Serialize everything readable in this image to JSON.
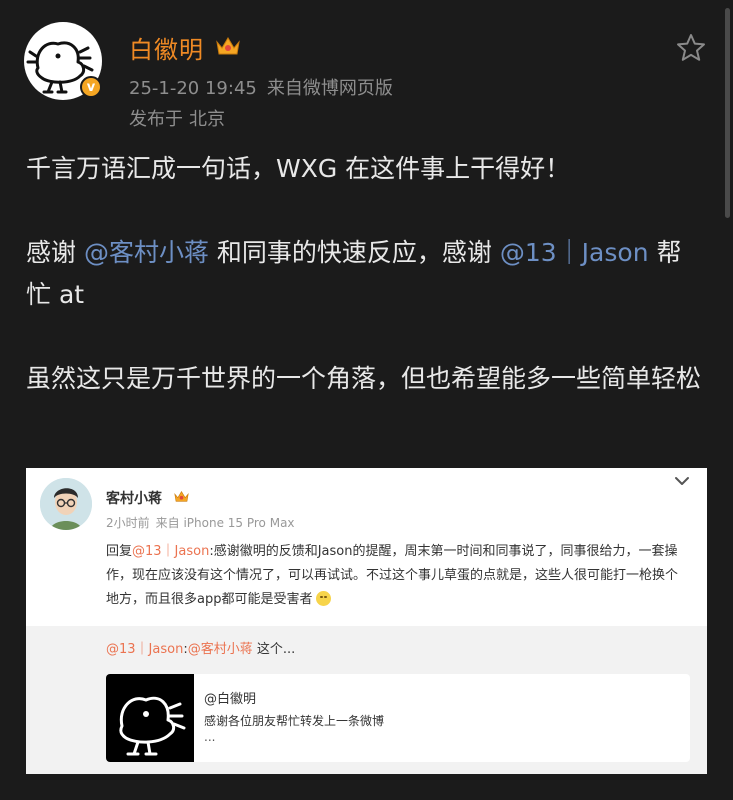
{
  "post": {
    "author": "白徽明",
    "timestamp": "25-1-20 19:45",
    "source": "来自微博网页版",
    "location_label": "发布于",
    "location": "北京",
    "colors": {
      "author": "#f08a24",
      "mention": "#6d8fc4",
      "verified": "#f5a623"
    },
    "line1": "千言万语汇成一句话，WXG 在这件事上干得好！",
    "p2_a": "感谢 ",
    "p2_mention1": "@客村小蒋",
    "p2_b": " 和同事的快速反应，感谢 ",
    "p2_mention2": "@13｜Jason",
    "p2_c": " 帮忙 at",
    "p3": "虽然这只是万千世界的一个角落，但也希望能多一些简单轻松"
  },
  "embed": {
    "name": "客村小蒋",
    "time": "2小时前",
    "source": "来自 iPhone 15 Pro Max",
    "reply_prefix": "回复",
    "reply_mention": "@13｜Jason",
    "reply_text": ":感谢徽明的反馈和Jason的提醒，周末第一时间和同事说了，同事很给力，一套操作，现在应该没有这个情况了，可以再试试。不过这个事儿草蛋的点就是，这些人很可能打一枪换个地方，而且很多app都可能是受害者",
    "quote_mention1": "@13｜Jason",
    "quote_colon": ":",
    "quote_mention2": "@客村小蒋",
    "quote_tail": " 这个...",
    "orig_author": "@白徽明",
    "orig_text": "感谢各位朋友帮忙转发上一条微博",
    "orig_more": "...",
    "colors": {
      "mention": "#eb7350"
    }
  }
}
